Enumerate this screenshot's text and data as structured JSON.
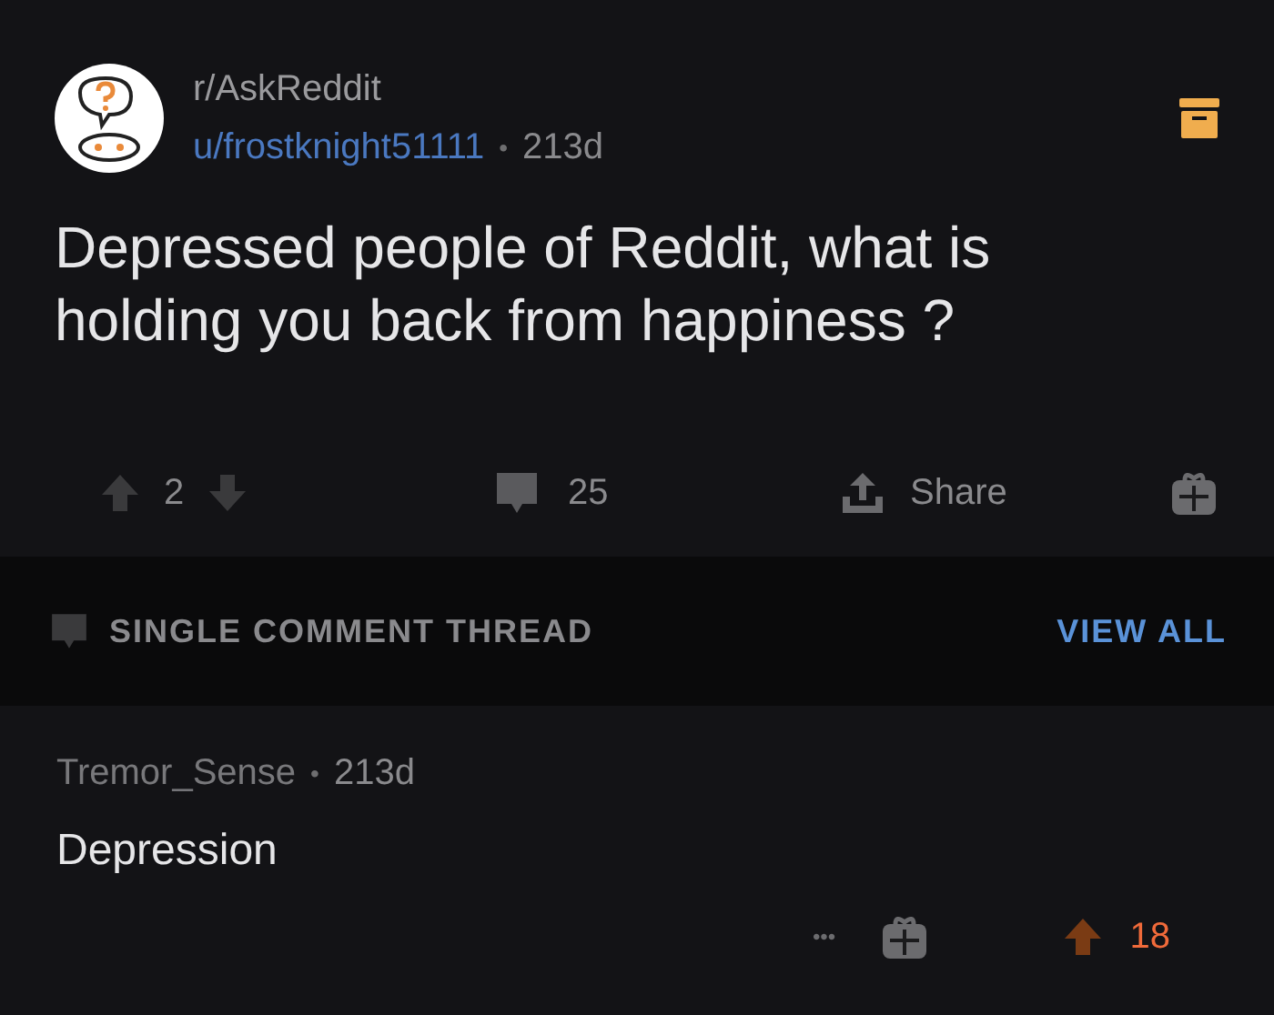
{
  "post": {
    "subreddit": "r/AskReddit",
    "author": "u/frostknight51111",
    "separator": "•",
    "age": "213d",
    "title": "Depressed people of Reddit, what is holding you back from happiness ?",
    "score": "2",
    "upvoted": false,
    "comments": "25",
    "share": "Share"
  },
  "thread_banner": {
    "label": "SINGLE COMMENT THREAD",
    "action": "VIEW ALL"
  },
  "comment": {
    "author": "Tremor_Sense",
    "separator": "•",
    "age": "213d",
    "body": "Depression",
    "more": "•••",
    "score": "18",
    "upvoted": true
  }
}
